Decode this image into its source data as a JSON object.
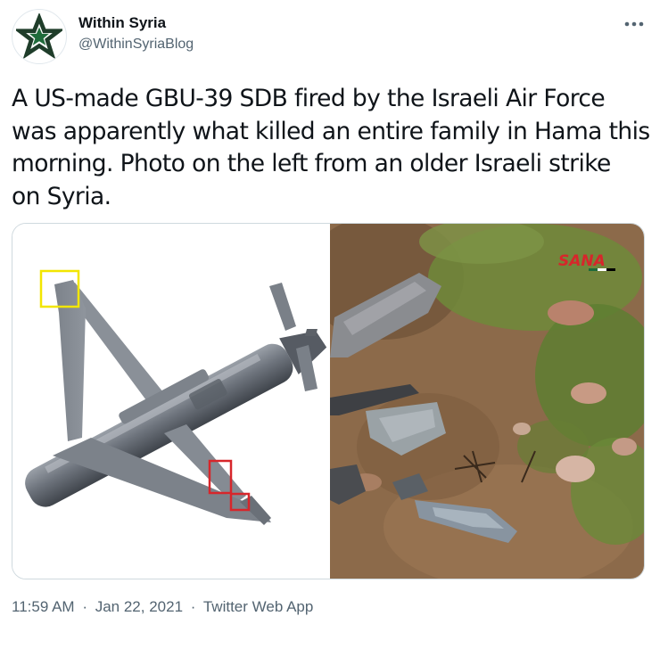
{
  "author": {
    "display_name": "Within Syria",
    "handle": "@WithinSyriaBlog"
  },
  "tweet": {
    "text_lines": [
      "A US-made GBU-39 SDB fired by the Israeli Air Force",
      "was apparently what killed an entire family in Hama this",
      "morning. Photo on the left from an older Israeli strike",
      "on Syria."
    ]
  },
  "media": {
    "watermark": "SANA"
  },
  "meta": {
    "time": "11:59 AM",
    "separator": "·",
    "date": "Jan 22, 2021",
    "source": "Twitter Web App"
  },
  "colors": {
    "text_primary": "#0f1419",
    "text_secondary": "#536471",
    "avatar_star": "#1f6b3a",
    "highlight_yellow": "#f2e600",
    "highlight_red": "#d7262b",
    "watermark_red": "#d7262b"
  },
  "icons": {
    "more": "more-horizontal-icon",
    "avatar": "green-star-logo"
  }
}
